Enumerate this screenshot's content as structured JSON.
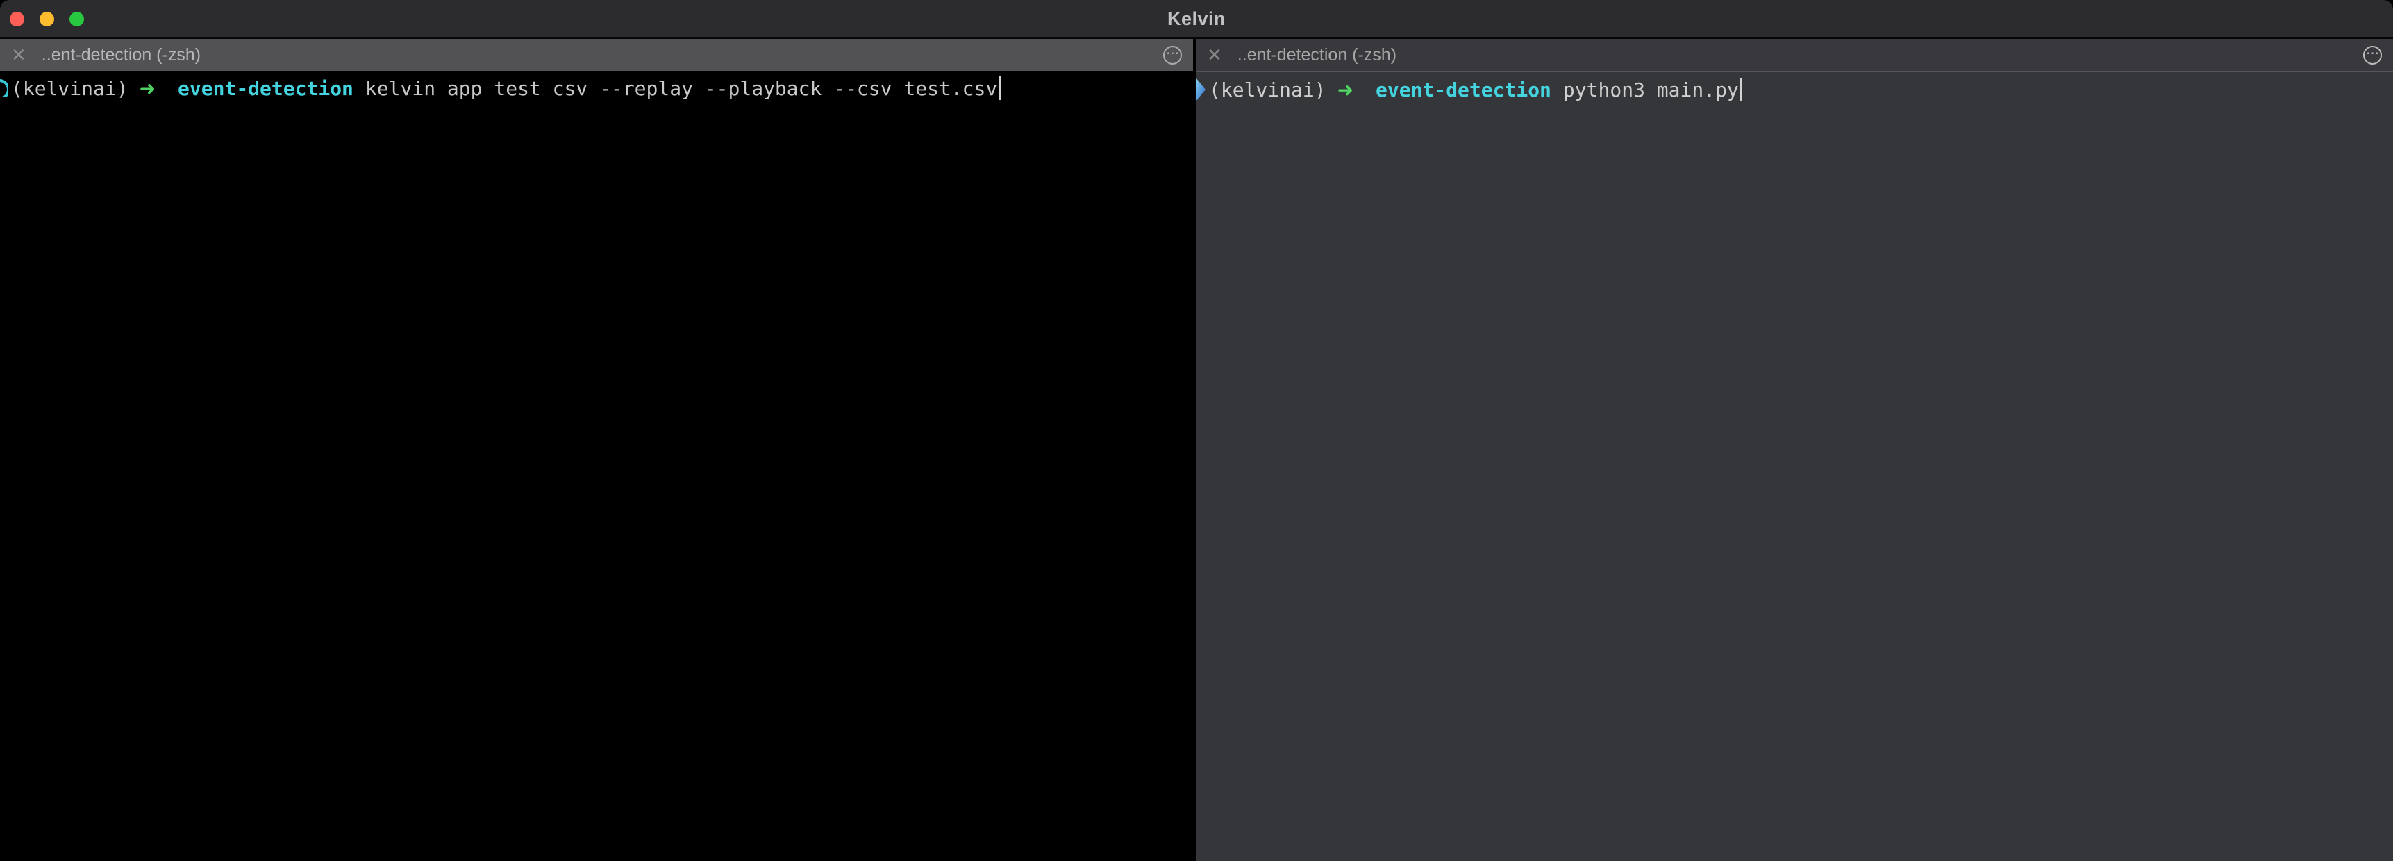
{
  "window": {
    "title": "Kelvin"
  },
  "colors": {
    "arrow_green": "#4fd463",
    "highlight_cyan": "#44d4e0",
    "left_pane_bg": "#000000",
    "right_pane_bg": "#353639",
    "traffic_red": "#ff5f57",
    "traffic_yellow": "#febc2e",
    "traffic_green": "#28c840"
  },
  "panes": [
    {
      "tab": {
        "label": "..ent-detection (-zsh)",
        "close_icon": "✕",
        "overflow_icon": "⋯"
      },
      "terminal": {
        "env": "(kelvinai)",
        "arrow": "➜",
        "command_highlight": "event-detection",
        "command_rest": "kelvin app test csv --replay --playback --csv test.csv"
      }
    },
    {
      "tab": {
        "label": "..ent-detection (-zsh)",
        "close_icon": "✕",
        "overflow_icon": "⋯"
      },
      "terminal": {
        "env": "(kelvinai)",
        "arrow": "➜",
        "command_highlight": "event-detection",
        "command_rest": "python3 main.py"
      }
    }
  ]
}
